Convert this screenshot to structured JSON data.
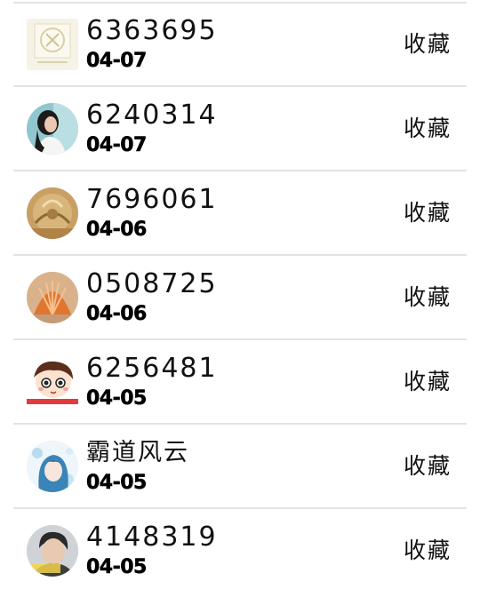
{
  "list": {
    "items": [
      {
        "name": "6363695",
        "date": "04-07",
        "action_label": "收藏",
        "avatar": "logo-avatar"
      },
      {
        "name": "6240314",
        "date": "04-07",
        "action_label": "收藏",
        "avatar": "girl-photo-avatar"
      },
      {
        "name": "7696061",
        "date": "04-06",
        "action_label": "收藏",
        "avatar": "golden-artwork-avatar"
      },
      {
        "name": "0508725",
        "date": "04-06",
        "action_label": "收藏",
        "avatar": "seashell-avatar"
      },
      {
        "name": "6256481",
        "date": "04-05",
        "action_label": "收藏",
        "avatar": "cartoon-boy-avatar"
      },
      {
        "name": "霸道风云",
        "date": "04-05",
        "action_label": "收藏",
        "avatar": "anime-girl-avatar"
      },
      {
        "name": "4148319",
        "date": "04-05",
        "action_label": "收藏",
        "avatar": "man-photo-avatar"
      }
    ]
  }
}
